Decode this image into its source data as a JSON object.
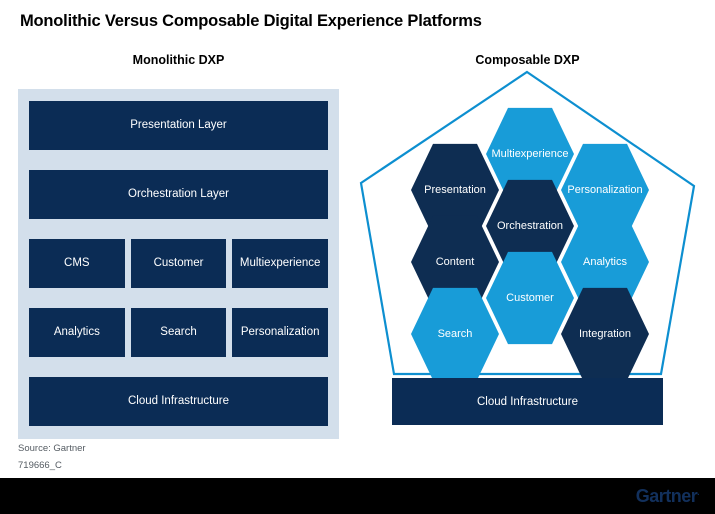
{
  "title": "Monolithic Versus Composable Digital Experience Platforms",
  "colors": {
    "dark_navy": "#0b2c55",
    "hex_dark": "#0e2d52",
    "hex_light": "#189cd8",
    "panel_bg": "#d3dfeb",
    "pentagon_stroke": "#0d8fd0",
    "footer_bg": "#000000",
    "logo": "#12305c"
  },
  "left": {
    "heading": "Monolithic DXP",
    "rows": [
      {
        "cells": [
          "Presentation Layer"
        ]
      },
      {
        "cells": [
          "Orchestration Layer"
        ]
      },
      {
        "cells": [
          "CMS",
          "Customer",
          "Multiexperience"
        ]
      },
      {
        "cells": [
          "Analytics",
          "Search",
          "Personalization"
        ]
      },
      {
        "cells": [
          "Cloud Infrastructure"
        ]
      }
    ]
  },
  "right": {
    "heading": "Composable DXP",
    "hexagons": [
      {
        "id": "presentation",
        "label": "Presentation",
        "tone": "dark"
      },
      {
        "id": "content",
        "label": "Content",
        "tone": "dark"
      },
      {
        "id": "search",
        "label": "Search",
        "tone": "light"
      },
      {
        "id": "multiexperience",
        "label": "Multiexperience",
        "tone": "light"
      },
      {
        "id": "orchestration",
        "label": "Orchestration",
        "tone": "dark"
      },
      {
        "id": "customer",
        "label": "Customer",
        "tone": "light"
      },
      {
        "id": "personalization",
        "label": "Personalization",
        "tone": "light"
      },
      {
        "id": "analytics",
        "label": "Analytics",
        "tone": "light"
      },
      {
        "id": "integration",
        "label": "Integration",
        "tone": "dark"
      }
    ],
    "cloud_label": "Cloud Infrastructure"
  },
  "footer": {
    "source": "Source: Gartner",
    "figure_id": "719666_C",
    "logo_text": "Gartner",
    "logo_mark": "."
  }
}
